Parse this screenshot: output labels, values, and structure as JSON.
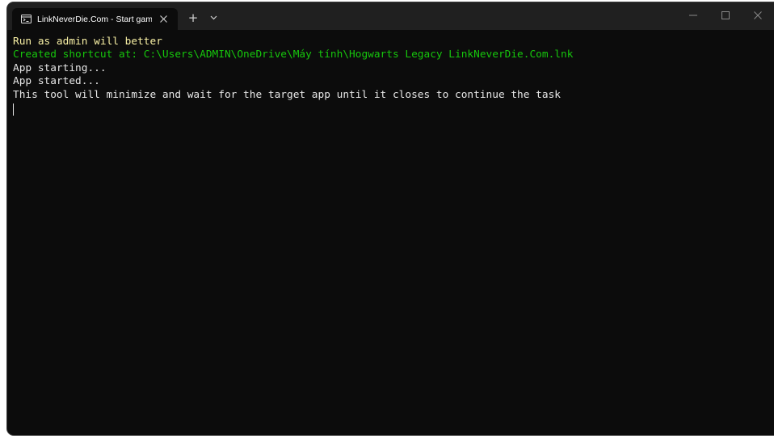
{
  "tab": {
    "title": "LinkNeverDie.Com - Start gam",
    "icon": "terminal-icon",
    "close_icon": "close-icon"
  },
  "toolbar": {
    "new_tab_label": "+",
    "dropdown_icon": "chevron-down-icon"
  },
  "window_controls": {
    "minimize_icon": "minimize-icon",
    "maximize_icon": "maximize-icon",
    "close_icon": "close-icon"
  },
  "terminal": {
    "lines": [
      {
        "text": "Run as admin will better",
        "color": "#f9f1a5"
      },
      {
        "text": "Created shortcut at: C:\\Users\\ADMIN\\OneDrive\\Máy tính\\Hogwarts Legacy LinkNeverDie.Com.lnk",
        "color": "#16c60c"
      },
      {
        "text": "App starting...",
        "color": "#e8e8e8"
      },
      {
        "text": "App started...",
        "color": "#e8e8e8"
      },
      {
        "text": "This tool will minimize and wait for the target app until it closes to continue the task",
        "color": "#e8e8e8"
      }
    ]
  },
  "colors": {
    "titlebar_bg": "#202020",
    "terminal_bg": "#0c0c0c",
    "yellow_text": "#f9f1a5",
    "green_text": "#16c60c"
  }
}
